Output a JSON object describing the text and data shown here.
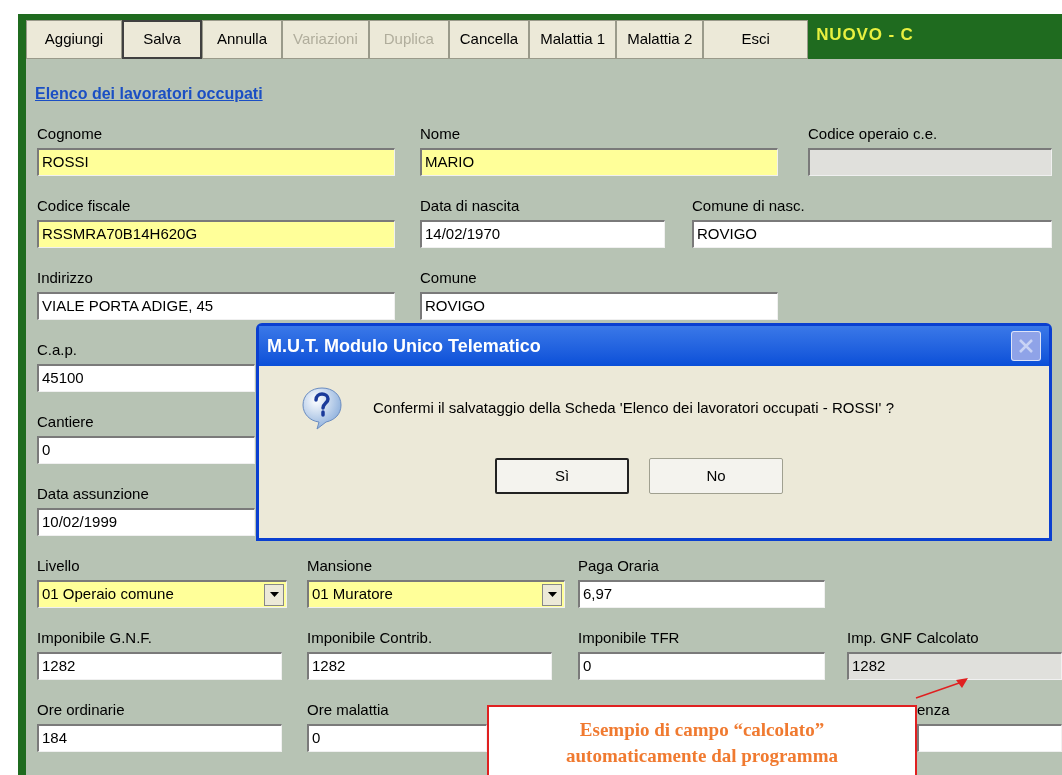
{
  "toolbar": {
    "buttons": [
      {
        "label": "Aggiungi",
        "disabled": false,
        "focused": false
      },
      {
        "label": "Salva",
        "disabled": false,
        "focused": true
      },
      {
        "label": "Annulla",
        "disabled": false,
        "focused": false
      },
      {
        "label": "Variazioni",
        "disabled": true,
        "focused": false
      },
      {
        "label": "Duplica",
        "disabled": true,
        "focused": false
      },
      {
        "label": "Cancella",
        "disabled": false,
        "focused": false
      },
      {
        "label": "Malattia 1",
        "disabled": false,
        "focused": false
      },
      {
        "label": "Malattia 2",
        "disabled": false,
        "focused": false
      },
      {
        "label": "Esci",
        "disabled": false,
        "focused": false
      }
    ],
    "mode_title": "NUOVO - C"
  },
  "section_link": "Elenco dei lavoratori occupati",
  "form_rows": [
    [
      {
        "label": "Cognome",
        "value": "ROSSI",
        "required": true,
        "readonly": false,
        "dropdown": false
      },
      {
        "label": "Nome",
        "value": "MARIO",
        "required": true,
        "readonly": false,
        "dropdown": false
      },
      {
        "label": "Codice operaio c.e.",
        "required": false,
        "readonly": true,
        "dropdown": false
      }
    ],
    [
      {
        "label": "Codice fiscale",
        "value": "RSSMRA70B14H620G",
        "required": true,
        "readonly": false,
        "dropdown": false
      },
      {
        "label": "Data di nascita",
        "value": "14/02/1970",
        "required": false,
        "readonly": false,
        "dropdown": false
      },
      {
        "label": "Comune di nasc.",
        "value": "ROVIGO",
        "required": false,
        "readonly": false,
        "dropdown": false
      }
    ],
    [
      {
        "label": "Indirizzo",
        "value": "VIALE PORTA ADIGE, 45",
        "required": false,
        "readonly": false,
        "dropdown": false
      },
      {
        "label": "Comune",
        "value": "ROVIGO",
        "required": false,
        "readonly": false,
        "dropdown": false
      }
    ],
    [
      {
        "label": "C.a.p.",
        "value": "45100",
        "required": false,
        "readonly": false,
        "dropdown": false
      }
    ],
    [
      {
        "label": "Cantiere",
        "value": "0",
        "required": false,
        "readonly": false,
        "dropdown": false
      }
    ],
    [
      {
        "label": "Data assunzione",
        "value": "10/02/1999",
        "required": false,
        "readonly": false,
        "dropdown": false
      }
    ],
    [
      {
        "label": "Livello",
        "value": "01 Operaio comune",
        "required": true,
        "readonly": false,
        "dropdown": true
      },
      {
        "label": "Mansione",
        "value": "01 Muratore",
        "required": true,
        "readonly": false,
        "dropdown": true
      },
      {
        "label": "Paga Oraria",
        "value": "6,97",
        "required": false,
        "readonly": false,
        "dropdown": false
      }
    ],
    [
      {
        "label": "Imponibile G.N.F.",
        "value": "1282",
        "required": false,
        "readonly": false,
        "dropdown": false
      },
      {
        "label": "Imponibile Contrib.",
        "value": "1282",
        "required": false,
        "readonly": false,
        "dropdown": false
      },
      {
        "label": "Imponibile TFR",
        "value": "0",
        "required": false,
        "readonly": false,
        "dropdown": false
      },
      {
        "label": "Imp. GNF Calcolato",
        "value": "1282",
        "required": false,
        "readonly": true,
        "dropdown": false
      }
    ],
    [
      {
        "label": "Ore ordinarie",
        "value": "184",
        "required": false,
        "readonly": false,
        "dropdown": false
      },
      {
        "label": "Ore malattia",
        "value": "0",
        "required": false,
        "readonly": false,
        "dropdown": false
      },
      {
        "label": "enza",
        "required": false,
        "readonly": false,
        "dropdown": false
      }
    ]
  ],
  "dialog": {
    "title": "M.U.T. Modulo Unico Telematico",
    "message": "Confermi il salvataggio della Scheda 'Elenco dei lavoratori occupati - ROSSI' ?",
    "buttons": [
      {
        "label": "Sì",
        "focused": true
      },
      {
        "label": "No",
        "focused": false
      }
    ]
  },
  "callout": {
    "text": "Esempio di campo “calcolato” automaticamente dal programma"
  }
}
